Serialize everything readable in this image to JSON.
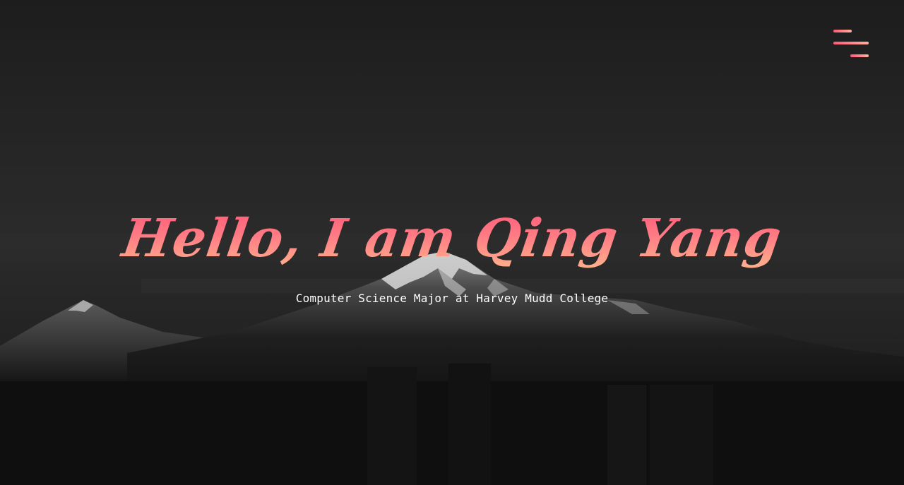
{
  "hero": {
    "title": "Hello, I am Qing Yang",
    "subtitle": "Computer Science Major at Harvey Mudd College"
  },
  "menu": {
    "icon": "hamburger-menu-icon"
  },
  "background": {
    "scene": "mountain-landscape"
  },
  "colors": {
    "accent_start": "#ff4f73",
    "accent_end": "#ffc090",
    "subtitle": "#ffffff",
    "background": "#1b1b1b"
  }
}
